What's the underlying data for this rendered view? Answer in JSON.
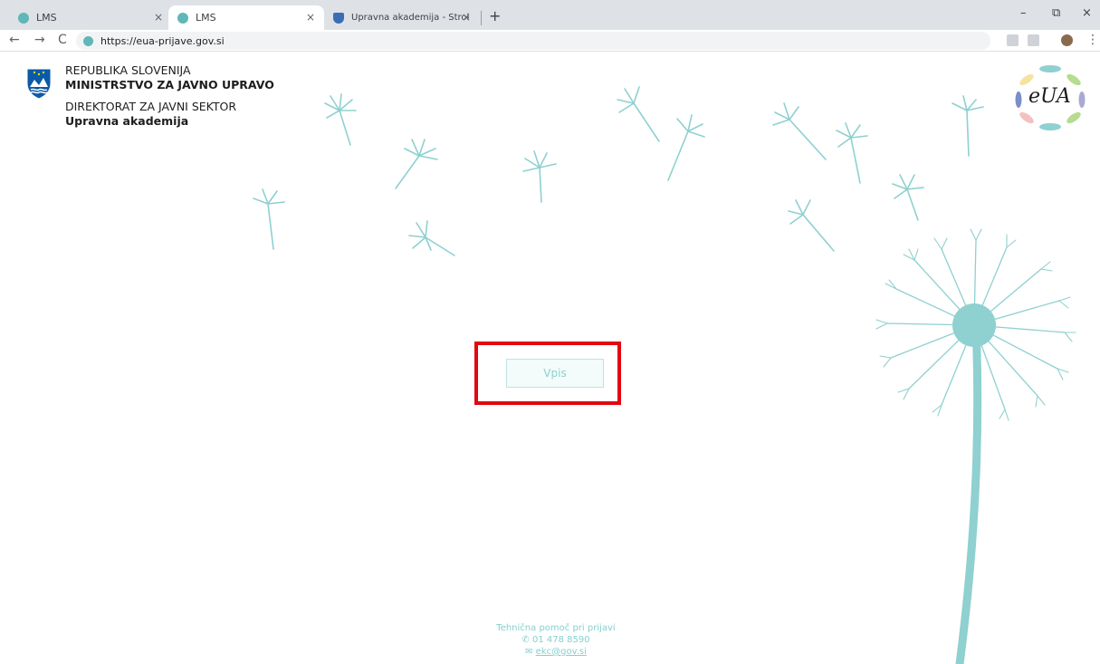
{
  "browser": {
    "tabs": [
      {
        "title": "LMS",
        "close_label": "×"
      },
      {
        "title": "LMS",
        "close_label": "×"
      },
      {
        "title": "Upravna akademija - Strokovni iz",
        "close_label": "×"
      }
    ],
    "new_tab_label": "+",
    "window_controls": {
      "minimize": "–",
      "restore": "⧉",
      "close": "×"
    },
    "nav": {
      "back": "←",
      "forward": "→",
      "reload": "C"
    },
    "url": "https://eua-prijave.gov.si",
    "menu_label": "⋮"
  },
  "header": {
    "org_line1": "REPUBLIKA SLOVENIJA",
    "org_line2": "MINISTRSTVO ZA JAVNO UPRAVO",
    "org_line3": "DIREKTORAT ZA JAVNI SEKTOR",
    "org_line4": "Upravna akademija"
  },
  "logo": {
    "text": "eUA"
  },
  "main": {
    "enroll_button_label": "Vpis"
  },
  "footer": {
    "help_title": "Tehnična pomoč pri prijavi",
    "phone": "01 478 8590",
    "email": "ekc@gov.si"
  },
  "colors": {
    "accent": "#8fd0d0",
    "highlight": "#e30613",
    "crest_blue": "#0a5aa8"
  }
}
